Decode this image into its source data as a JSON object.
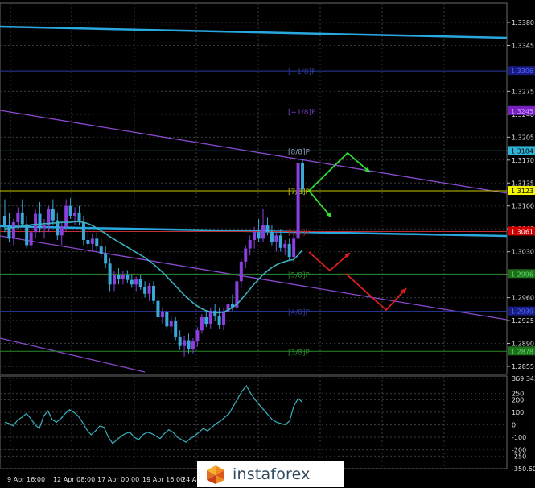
{
  "chart_data": {
    "type": "candlestick",
    "price_axis": {
      "ticks": [
        "1.3380",
        "1.3345",
        "1.3275",
        "1.3240",
        "1.3205",
        "1.3170",
        "1.3135",
        "1.3100",
        "1.3065",
        "1.3030",
        "1.2995",
        "1.2960",
        "1.2925",
        "1.2890",
        "1.2855"
      ],
      "range": [
        1.2855,
        1.338
      ]
    },
    "indicator_axis": {
      "ticks": [
        "369.3437",
        "250",
        "200",
        "100",
        "0",
        "-100",
        "-200",
        "-250",
        "-350.604"
      ]
    },
    "time_axis": {
      "ticks": [
        "9 Apr 16:00",
        "12 Apr 08:00",
        "17 Apr 00:00",
        "19 Apr 16:00",
        "24 Ap"
      ]
    },
    "price_labels": [
      {
        "text": "1.3184",
        "value": 1.3184,
        "bg": "#2fb3d6",
        "fg": "#000000"
      },
      {
        "text": "1.3123",
        "value": 1.3123,
        "bg": "#f5f500",
        "fg": "#000000"
      },
      {
        "text": "1.3061",
        "value": 1.3061,
        "bg": "#d00000",
        "fg": "#ffffff"
      },
      {
        "text": "1.3245",
        "value": 1.3245,
        "bg": "#7a1fc0",
        "fg": "#c9a0ff"
      },
      {
        "text": "1.3306",
        "value": 1.3306,
        "bg": "#1a1a80",
        "fg": "#4a6aff"
      },
      {
        "text": "1.2996",
        "value": 1.2996,
        "bg": "#1e6e1e",
        "fg": "#5edb5e"
      },
      {
        "text": "1.2939",
        "value": 1.2939,
        "bg": "#1a1a80",
        "fg": "#4a6aff"
      },
      {
        "text": "1.2878",
        "value": 1.2878,
        "bg": "#1e6e1e",
        "fg": "#5edb5e"
      }
    ],
    "murrey_labels": [
      {
        "text": "[+1/8]P",
        "value": 1.3306,
        "color": "#2a3aa0"
      },
      {
        "text": "[+1/8]P",
        "value": 1.3245,
        "color": "#7a3ac0"
      },
      {
        "text": "[8/8]P",
        "value": 1.3184,
        "color": "#8fa0b8"
      },
      {
        "text": "[7/8]P",
        "value": 1.3123,
        "color": "#c0c000"
      },
      {
        "text": "[6/8]P",
        "value": 1.3061,
        "color": "#b03030"
      },
      {
        "text": "[5/8]P",
        "value": 1.2996,
        "color": "#2a8a2a"
      },
      {
        "text": "[4/8]P",
        "value": 1.2939,
        "color": "#2a3aa0"
      },
      {
        "text": "[3/8]P",
        "value": 1.2878,
        "color": "#2a8a2a"
      }
    ],
    "colors": {
      "bull": "#8b3fe0",
      "bear": "#3aa8d8",
      "ma": "#3ab0c0",
      "indicator": "#3ab0c0",
      "channel": "#8a4ad0",
      "long_trend": "#29a8e0",
      "arrow_green": "#30e030",
      "arrow_red": "#e02020"
    },
    "candles": [
      {
        "o": 1.3085,
        "h": 1.311,
        "l": 1.306,
        "c": 1.307
      },
      {
        "o": 1.307,
        "h": 1.309,
        "l": 1.3045,
        "c": 1.305
      },
      {
        "o": 1.305,
        "h": 1.308,
        "l": 1.304,
        "c": 1.3075
      },
      {
        "o": 1.3075,
        "h": 1.3098,
        "l": 1.3065,
        "c": 1.309
      },
      {
        "o": 1.309,
        "h": 1.311,
        "l": 1.307,
        "c": 1.3072
      },
      {
        "o": 1.3072,
        "h": 1.3085,
        "l": 1.3035,
        "c": 1.304
      },
      {
        "o": 1.304,
        "h": 1.3068,
        "l": 1.303,
        "c": 1.306
      },
      {
        "o": 1.306,
        "h": 1.3095,
        "l": 1.305,
        "c": 1.3088
      },
      {
        "o": 1.3088,
        "h": 1.3106,
        "l": 1.306,
        "c": 1.3066
      },
      {
        "o": 1.3066,
        "h": 1.308,
        "l": 1.305,
        "c": 1.307
      },
      {
        "o": 1.307,
        "h": 1.31,
        "l": 1.306,
        "c": 1.3095
      },
      {
        "o": 1.3095,
        "h": 1.311,
        "l": 1.307,
        "c": 1.3078
      },
      {
        "o": 1.3078,
        "h": 1.309,
        "l": 1.3048,
        "c": 1.3055
      },
      {
        "o": 1.3055,
        "h": 1.3075,
        "l": 1.304,
        "c": 1.3068
      },
      {
        "o": 1.3068,
        "h": 1.311,
        "l": 1.306,
        "c": 1.31
      },
      {
        "o": 1.31,
        "h": 1.3112,
        "l": 1.308,
        "c": 1.3085
      },
      {
        "o": 1.3085,
        "h": 1.3098,
        "l": 1.307,
        "c": 1.309
      },
      {
        "o": 1.309,
        "h": 1.31,
        "l": 1.307,
        "c": 1.3075
      },
      {
        "o": 1.3075,
        "h": 1.3085,
        "l": 1.304,
        "c": 1.3048
      },
      {
        "o": 1.3048,
        "h": 1.3062,
        "l": 1.3035,
        "c": 1.3042
      },
      {
        "o": 1.3042,
        "h": 1.3058,
        "l": 1.303,
        "c": 1.305
      },
      {
        "o": 1.305,
        "h": 1.306,
        "l": 1.303,
        "c": 1.3038
      },
      {
        "o": 1.3038,
        "h": 1.305,
        "l": 1.302,
        "c": 1.3026
      },
      {
        "o": 1.3026,
        "h": 1.3038,
        "l": 1.3005,
        "c": 1.3012
      },
      {
        "o": 1.3012,
        "h": 1.302,
        "l": 1.297,
        "c": 1.298
      },
      {
        "o": 1.298,
        "h": 1.3,
        "l": 1.297,
        "c": 1.2995
      },
      {
        "o": 1.2995,
        "h": 1.3005,
        "l": 1.298,
        "c": 1.2988
      },
      {
        "o": 1.2988,
        "h": 1.3,
        "l": 1.298,
        "c": 1.2995
      },
      {
        "o": 1.2995,
        "h": 1.3002,
        "l": 1.2982,
        "c": 1.2987
      },
      {
        "o": 1.2987,
        "h": 1.2996,
        "l": 1.2975,
        "c": 1.298
      },
      {
        "o": 1.298,
        "h": 1.2992,
        "l": 1.297,
        "c": 1.2988
      },
      {
        "o": 1.2988,
        "h": 1.2995,
        "l": 1.2972,
        "c": 1.2976
      },
      {
        "o": 1.2976,
        "h": 1.2985,
        "l": 1.296,
        "c": 1.2966
      },
      {
        "o": 1.2966,
        "h": 1.2982,
        "l": 1.2955,
        "c": 1.2978
      },
      {
        "o": 1.2978,
        "h": 1.2985,
        "l": 1.295,
        "c": 1.2955
      },
      {
        "o": 1.2955,
        "h": 1.296,
        "l": 1.2925,
        "c": 1.293
      },
      {
        "o": 1.293,
        "h": 1.2945,
        "l": 1.292,
        "c": 1.2938
      },
      {
        "o": 1.2938,
        "h": 1.2942,
        "l": 1.291,
        "c": 1.2916
      },
      {
        "o": 1.2916,
        "h": 1.2932,
        "l": 1.2905,
        "c": 1.2925
      },
      {
        "o": 1.2925,
        "h": 1.293,
        "l": 1.2895,
        "c": 1.29
      },
      {
        "o": 1.29,
        "h": 1.291,
        "l": 1.288,
        "c": 1.2886
      },
      {
        "o": 1.2886,
        "h": 1.2902,
        "l": 1.287,
        "c": 1.2895
      },
      {
        "o": 1.2895,
        "h": 1.2905,
        "l": 1.2875,
        "c": 1.2882
      },
      {
        "o": 1.2882,
        "h": 1.2898,
        "l": 1.2875,
        "c": 1.2893
      },
      {
        "o": 1.2893,
        "h": 1.2915,
        "l": 1.2885,
        "c": 1.291
      },
      {
        "o": 1.291,
        "h": 1.2935,
        "l": 1.2905,
        "c": 1.293
      },
      {
        "o": 1.293,
        "h": 1.294,
        "l": 1.2915,
        "c": 1.292
      },
      {
        "o": 1.292,
        "h": 1.2945,
        "l": 1.2912,
        "c": 1.294
      },
      {
        "o": 1.294,
        "h": 1.295,
        "l": 1.2925,
        "c": 1.2932
      },
      {
        "o": 1.2932,
        "h": 1.2945,
        "l": 1.2912,
        "c": 1.2918
      },
      {
        "o": 1.2918,
        "h": 1.2945,
        "l": 1.291,
        "c": 1.2938
      },
      {
        "o": 1.2938,
        "h": 1.2955,
        "l": 1.293,
        "c": 1.295
      },
      {
        "o": 1.295,
        "h": 1.2965,
        "l": 1.294,
        "c": 1.2945
      },
      {
        "o": 1.2945,
        "h": 1.299,
        "l": 1.294,
        "c": 1.2985
      },
      {
        "o": 1.2985,
        "h": 1.302,
        "l": 1.2975,
        "c": 1.3015
      },
      {
        "o": 1.3015,
        "h": 1.304,
        "l": 1.3005,
        "c": 1.3035
      },
      {
        "o": 1.3035,
        "h": 1.3055,
        "l": 1.3025,
        "c": 1.3048
      },
      {
        "o": 1.3048,
        "h": 1.3068,
        "l": 1.3035,
        "c": 1.306
      },
      {
        "o": 1.306,
        "h": 1.308,
        "l": 1.3045,
        "c": 1.305
      },
      {
        "o": 1.305,
        "h": 1.3095,
        "l": 1.3045,
        "c": 1.307
      },
      {
        "o": 1.307,
        "h": 1.3082,
        "l": 1.3055,
        "c": 1.306
      },
      {
        "o": 1.306,
        "h": 1.307,
        "l": 1.304,
        "c": 1.3045
      },
      {
        "o": 1.3045,
        "h": 1.306,
        "l": 1.303,
        "c": 1.3055
      },
      {
        "o": 1.3055,
        "h": 1.3065,
        "l": 1.303,
        "c": 1.3036
      },
      {
        "o": 1.3036,
        "h": 1.3048,
        "l": 1.3025,
        "c": 1.3042
      },
      {
        "o": 1.3042,
        "h": 1.305,
        "l": 1.3018,
        "c": 1.3022
      },
      {
        "o": 1.3022,
        "h": 1.306,
        "l": 1.3015,
        "c": 1.305
      },
      {
        "o": 1.305,
        "h": 1.317,
        "l": 1.3045,
        "c": 1.3165
      },
      {
        "o": 1.3165,
        "h": 1.3172,
        "l": 1.3118,
        "c": 1.3125
      }
    ],
    "ma_values": [
      1.3065,
      1.3066,
      1.3067,
      1.3068,
      1.3069,
      1.307,
      1.3071,
      1.3072,
      1.3072,
      1.3073,
      1.3073,
      1.3074,
      1.3074,
      1.3075,
      1.3075,
      1.3075,
      1.3076,
      1.3076,
      1.3075,
      1.3073,
      1.307,
      1.3066,
      1.3062,
      1.3058,
      1.3053,
      1.3049,
      1.3045,
      1.3041,
      1.3037,
      1.3033,
      1.3029,
      1.3025,
      1.3021,
      1.3016,
      1.3011,
      1.3005,
      1.2999,
      1.2992,
      1.2985,
      1.2978,
      1.2971,
      1.2964,
      1.2958,
      1.2952,
      1.2947,
      1.2943,
      1.294,
      1.2938,
      1.2937,
      1.2937,
      1.2938,
      1.2941,
      1.2945,
      1.295,
      1.2957,
      1.2965,
      1.2973,
      1.2981,
      1.2988,
      1.2995,
      1.3001,
      1.3006,
      1.301,
      1.3013,
      1.3015,
      1.3017,
      1.3018,
      1.3025,
      1.3033
    ],
    "indicator_values": [
      20,
      10,
      -10,
      40,
      60,
      90,
      50,
      0,
      -30,
      70,
      110,
      40,
      20,
      50,
      90,
      120,
      100,
      70,
      20,
      -40,
      -80,
      -50,
      -10,
      -20,
      -100,
      -150,
      -120,
      -90,
      -70,
      -60,
      -100,
      -120,
      -80,
      -60,
      -70,
      -90,
      -110,
      -70,
      -40,
      -60,
      -100,
      -120,
      -140,
      -110,
      -90,
      -60,
      -30,
      -50,
      -20,
      10,
      30,
      60,
      90,
      150,
      210,
      270,
      310,
      250,
      200,
      160,
      120,
      80,
      40,
      20,
      10,
      0,
      30,
      150,
      210,
      180
    ]
  }
}
